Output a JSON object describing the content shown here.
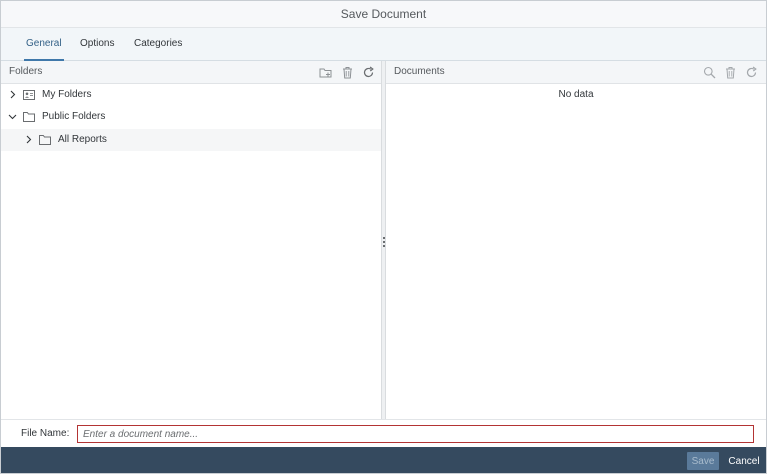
{
  "dialog": {
    "title": "Save Document"
  },
  "tabs": [
    {
      "label": "General",
      "active": true
    },
    {
      "label": "Options",
      "active": false
    },
    {
      "label": "Categories",
      "active": false
    }
  ],
  "folders_panel": {
    "label": "Folders",
    "actions": [
      "new-folder-icon",
      "delete-icon",
      "refresh-icon"
    ],
    "tree": [
      {
        "label": "My Folders",
        "expanded": false,
        "icon": "personal-folder-icon"
      },
      {
        "label": "Public Folders",
        "expanded": true,
        "icon": "folder-icon"
      },
      {
        "label": "All Reports",
        "expanded": false,
        "icon": "folder-icon"
      }
    ]
  },
  "documents_panel": {
    "label": "Documents",
    "actions": [
      "search-icon",
      "delete-icon",
      "refresh-icon"
    ],
    "empty_text": "No data"
  },
  "file_name": {
    "label": "File Name:",
    "value": "",
    "placeholder": "Enter a document name..."
  },
  "footer": {
    "save_label": "Save",
    "cancel_label": "Cancel"
  },
  "colors": {
    "accent": "#3f78aa",
    "footer_bg": "#354a5f",
    "input_error_border": "#b33434",
    "save_disabled_bg": "#5a7a9a"
  }
}
